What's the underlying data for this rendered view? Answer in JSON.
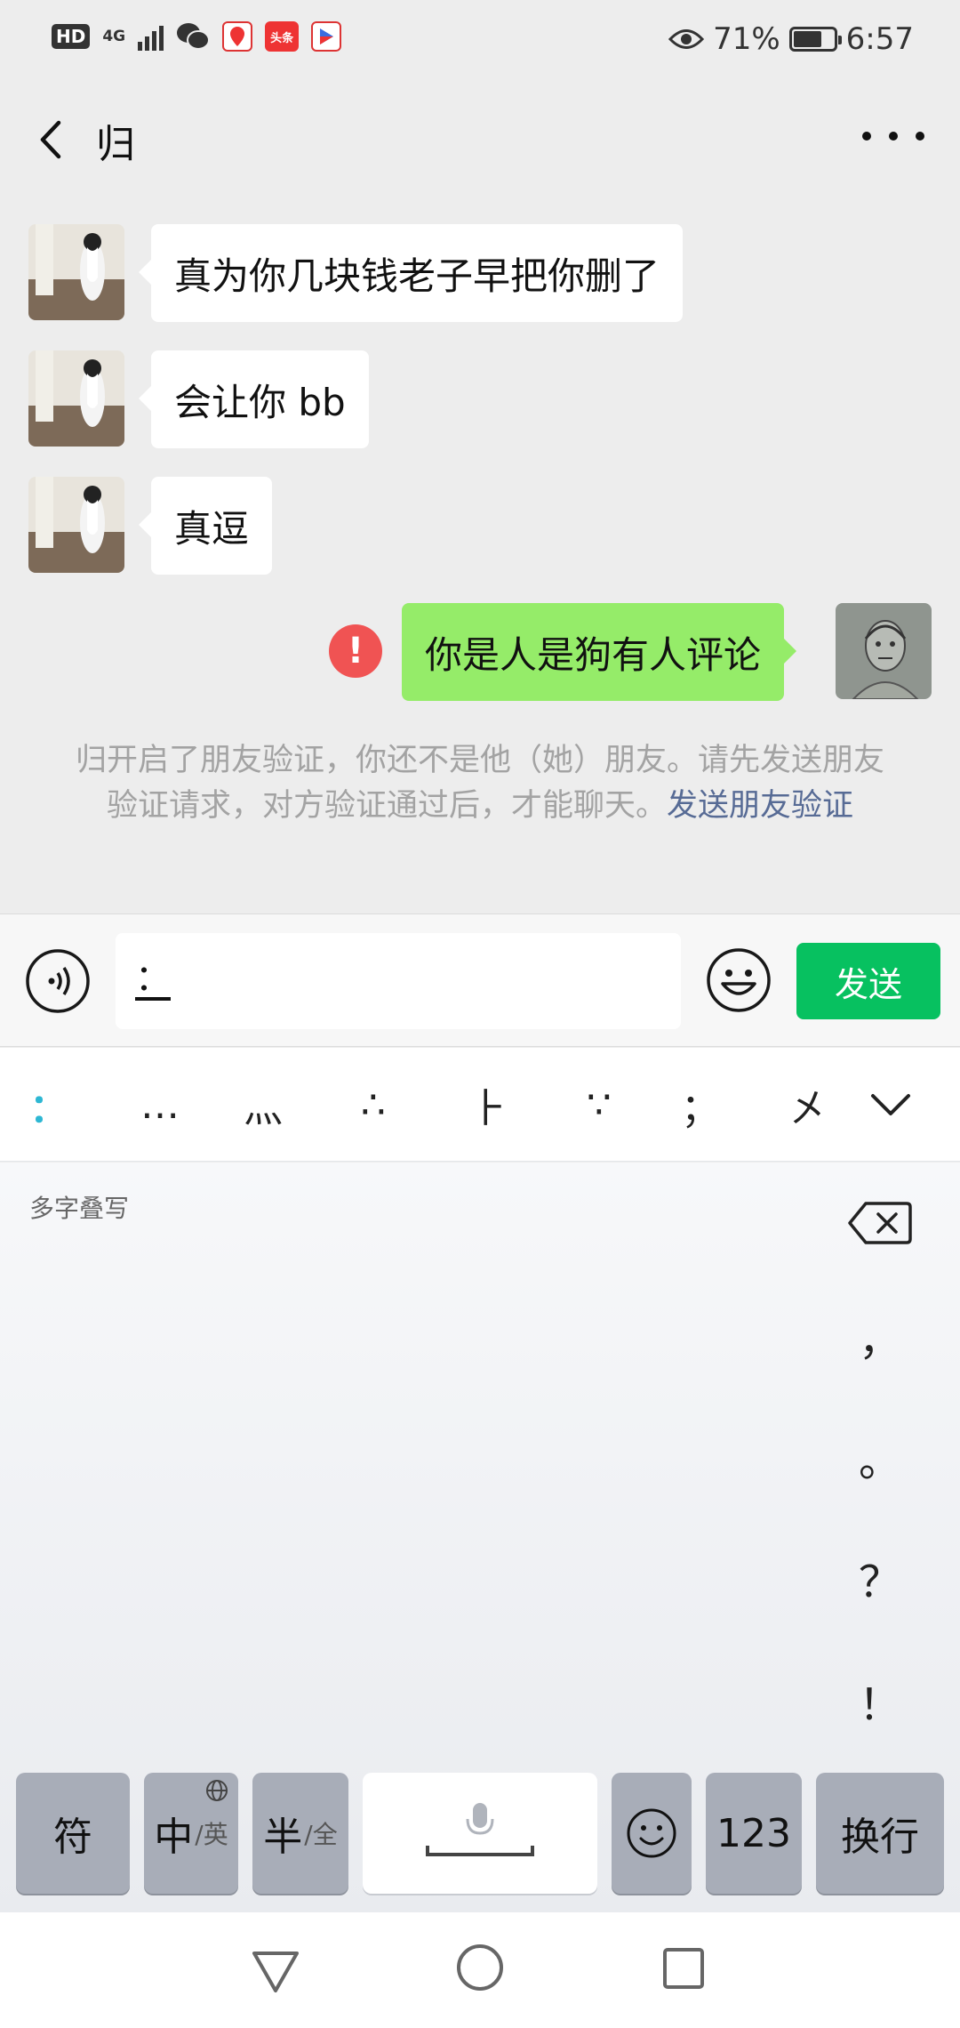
{
  "status_bar": {
    "hd": "HD",
    "network": "4G",
    "app_toutiao": "头条",
    "battery_percent": "71%",
    "battery_level": 0.71,
    "time": "6:57",
    "icons": [
      "hd-icon",
      "signal-icon",
      "wechat-icon",
      "location-app-icon",
      "toutiao-icon",
      "video-app-icon",
      "eye-icon",
      "battery-icon"
    ]
  },
  "header": {
    "title": "归"
  },
  "messages": [
    {
      "direction": "in",
      "text": "真为你几块钱老子早把你删了"
    },
    {
      "direction": "in",
      "text": "会让你 bb"
    },
    {
      "direction": "in",
      "text": "真逗"
    },
    {
      "direction": "out",
      "text": "你是人是狗有人评论",
      "status": "failed"
    }
  ],
  "system_notice": {
    "text": "归开启了朋友验证，你还不是他（她）朋友。请先发送朋友验证请求，对方验证通过后，才能聊天。",
    "link": "发送朋友验证"
  },
  "input_bar": {
    "value": "：",
    "send_label": "发送"
  },
  "keyboard": {
    "candidates": [
      "：",
      "…",
      "灬",
      "∴",
      "⺊",
      "∵",
      "；",
      "㐅"
    ],
    "hint": "多字叠写",
    "punctuation": [
      "，",
      "。",
      "？",
      "！"
    ],
    "keys": {
      "symbol": "符",
      "lang_main": "中",
      "lang_sub": "/英",
      "width_main": "半",
      "width_sub": "/全",
      "numeric": "123",
      "enter": "换行"
    }
  },
  "colors": {
    "send_green": "#07c160",
    "bubble_out": "#95ec69",
    "link": "#576b95",
    "error_red": "#f05353"
  }
}
